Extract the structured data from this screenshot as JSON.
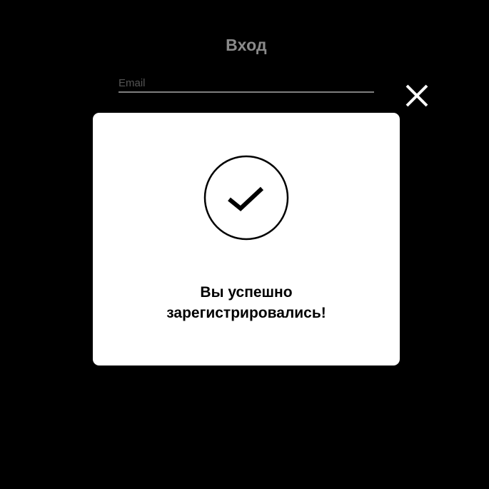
{
  "login": {
    "title": "Вход",
    "email_placeholder": "Email"
  },
  "modal": {
    "icon": "check-circle-icon",
    "message_line1": "Вы успешно",
    "message_line2": "зарегистрировались!"
  },
  "icons": {
    "close": "close-icon",
    "check": "check-circle-icon"
  },
  "colors": {
    "background": "#000000",
    "modal_background": "#ffffff",
    "title": "#8a8a8a",
    "input_underline": "#7f7f7f",
    "text": "#000000",
    "close_icon": "#ffffff"
  }
}
